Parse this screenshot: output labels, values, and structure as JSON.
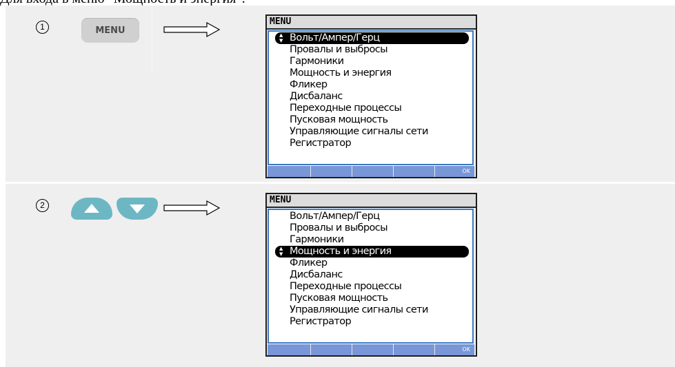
{
  "heading": "Для входа в меню \"Мощность и энергия\":",
  "steps": [
    {
      "number": "1",
      "key_label": "MENU",
      "screen": {
        "title": "MENU",
        "items": [
          "Вольт/Ампер/Герц",
          "Провалы и выбросы",
          "Гармоники",
          "Мощность и энергия",
          "Фликер",
          "Дисбаланс",
          "Переходные процессы",
          "Пусковая мощность",
          "Управляющие сигналы сети",
          "Регистратор"
        ],
        "selected_index": 0,
        "softkeys": [
          "",
          "",
          "",
          "",
          "OK"
        ]
      }
    },
    {
      "number": "2",
      "keys": [
        "up-arrow-icon",
        "down-arrow-icon"
      ],
      "screen": {
        "title": "MENU",
        "items": [
          "Вольт/Ампер/Герц",
          "Провалы и выбросы",
          "Гармоники",
          "Мощность и энергия",
          "Фликер",
          "Дисбаланс",
          "Переходные процессы",
          "Пусковая мощность",
          "Управляющие сигналы сети",
          "Регистратор"
        ],
        "selected_index": 3,
        "softkeys": [
          "",
          "",
          "",
          "",
          "OK"
        ]
      }
    }
  ],
  "selection_icon": "updown-arrows-icon",
  "colors": {
    "panel": "#efefef",
    "key_blue": "#6db7c4",
    "softkey": "#7896d8",
    "list_border": "#3a78c0"
  }
}
